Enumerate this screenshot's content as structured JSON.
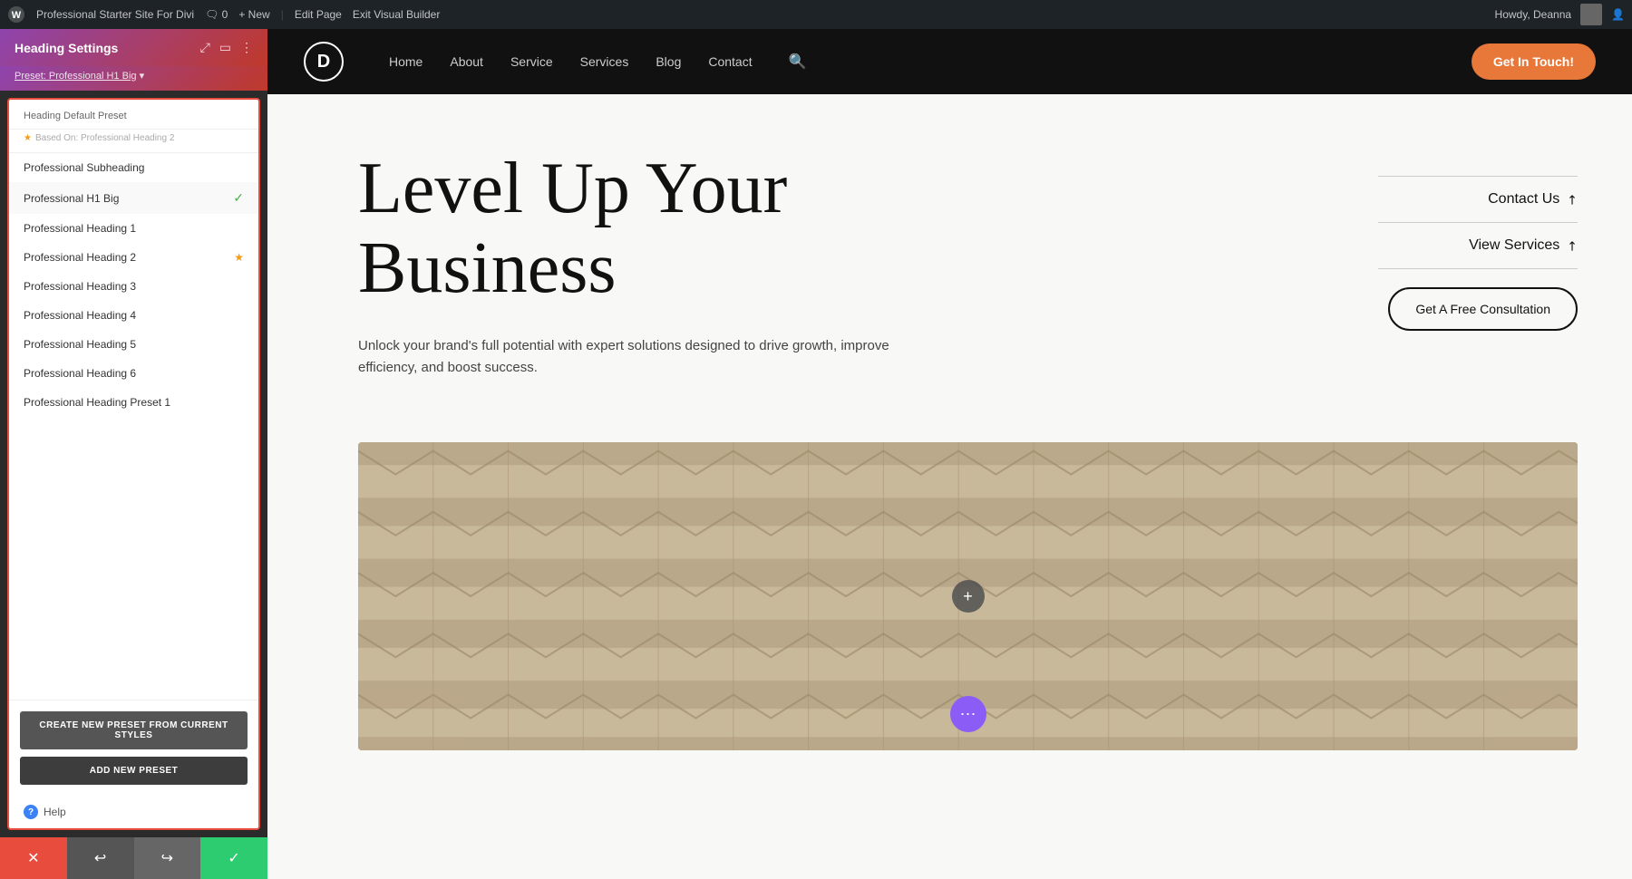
{
  "admin_bar": {
    "wp_logo": "W",
    "site_name": "Professional Starter Site For Divi",
    "comment_count": "0",
    "new_label": "+ New",
    "edit_page_label": "Edit Page",
    "exit_builder_label": "Exit Visual Builder",
    "howdy_label": "Howdy, Deanna"
  },
  "panel": {
    "title": "Heading Settings",
    "preset_bar_label": "Preset: Professional H1 Big",
    "dropdown_title": "Heading Default Preset",
    "based_on_label": "Based On: Professional Heading 2",
    "presets": [
      {
        "id": "professional-subheading",
        "label": "Professional Subheading",
        "active": false,
        "starred": false,
        "checked": false
      },
      {
        "id": "professional-h1-big",
        "label": "Professional H1 Big",
        "active": true,
        "starred": false,
        "checked": true
      },
      {
        "id": "professional-heading-1",
        "label": "Professional Heading 1",
        "active": false,
        "starred": false,
        "checked": false
      },
      {
        "id": "professional-heading-2",
        "label": "Professional Heading 2",
        "active": false,
        "starred": true,
        "checked": false
      },
      {
        "id": "professional-heading-3",
        "label": "Professional Heading 3",
        "active": false,
        "starred": false,
        "checked": false
      },
      {
        "id": "professional-heading-4",
        "label": "Professional Heading 4",
        "active": false,
        "starred": false,
        "checked": false
      },
      {
        "id": "professional-heading-5",
        "label": "Professional Heading 5",
        "active": false,
        "starred": false,
        "checked": false
      },
      {
        "id": "professional-heading-6",
        "label": "Professional Heading 6",
        "active": false,
        "starred": false,
        "checked": false
      },
      {
        "id": "professional-heading-preset-1",
        "label": "Professional Heading Preset 1",
        "active": false,
        "starred": false,
        "checked": false
      }
    ],
    "create_preset_btn": "Create New Preset From Current Styles",
    "add_preset_btn": "Add New Preset",
    "help_label": "Help"
  },
  "toolbar": {
    "close_icon": "✕",
    "undo_icon": "↩",
    "redo_icon": "↪",
    "save_icon": "✓"
  },
  "site_nav": {
    "logo_letter": "D",
    "links": [
      "Home",
      "About",
      "Service",
      "Services",
      "Blog",
      "Contact"
    ],
    "search_icon": "🔍",
    "cta_btn": "Get In Touch!"
  },
  "hero": {
    "heading_line1": "Level Up Your",
    "heading_line2": "Business",
    "subtext": "Unlock your brand's full potential with expert solutions designed to drive growth, improve efficiency, and boost success.",
    "contact_link": "Contact Us",
    "view_services_link": "View Services",
    "consultation_btn": "Get A Free Consultation",
    "arrow": "↗"
  },
  "colors": {
    "accent_orange": "#e8773a",
    "accent_purple": "#8b5cf6",
    "panel_gradient_start": "#8e44ad",
    "panel_gradient_end": "#c0392b",
    "check_green": "#4CAF50",
    "star_yellow": "#f39c12",
    "close_red": "#e74c3c",
    "save_green": "#2ecc71"
  }
}
